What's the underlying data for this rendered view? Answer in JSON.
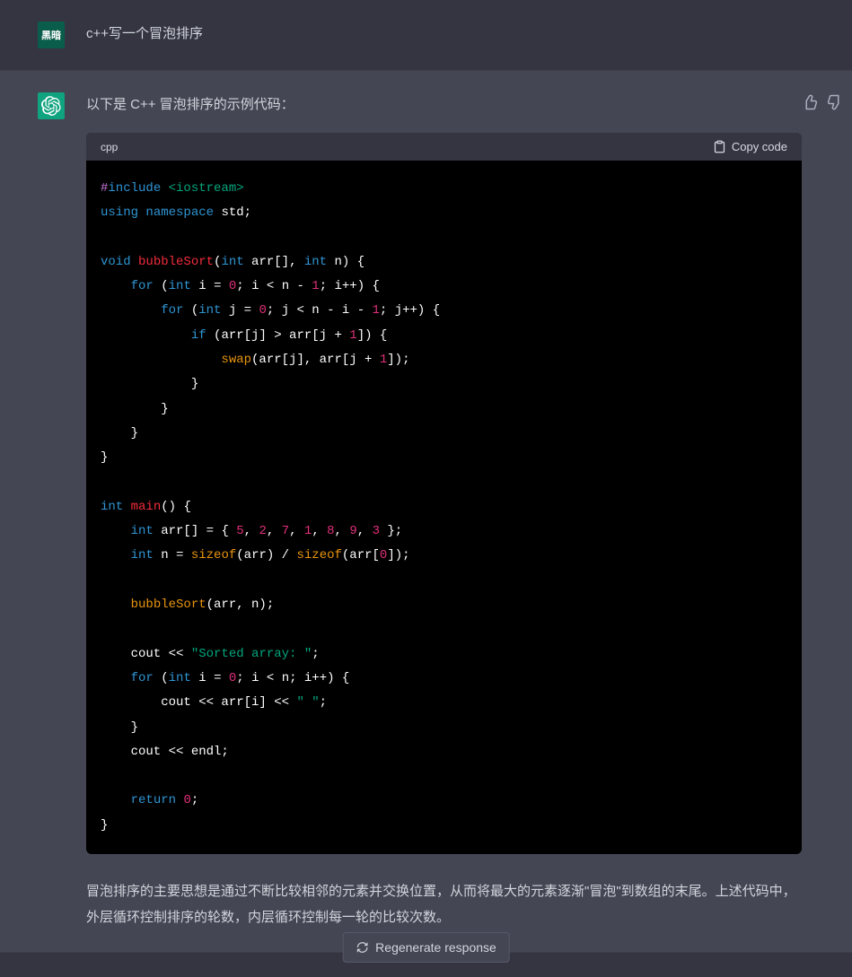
{
  "user": {
    "avatar_text": "黑暗",
    "message": "c++写一个冒泡排序"
  },
  "assistant": {
    "intro": "以下是 C++ 冒泡排序的示例代码：",
    "code_lang": "cpp",
    "copy_label": "Copy code",
    "code": {
      "l1_a": "#",
      "l1_b": "include",
      "l1_c": " <iostream>",
      "l2_a": "using",
      "l2_b": " ",
      "l2_c": "namespace",
      "l2_d": " std;",
      "l3_a": "void",
      "l3_b": " ",
      "l3_c": "bubbleSort",
      "l3_d": "(",
      "l3_e": "int",
      "l3_f": " arr[], ",
      "l3_g": "int",
      "l3_h": " n)",
      "l3_i": " {",
      "l4_a": "    ",
      "l4_b": "for",
      "l4_c": " (",
      "l4_d": "int",
      "l4_e": " i = ",
      "l4_f": "0",
      "l4_g": "; i < n - ",
      "l4_h": "1",
      "l4_i": "; i++) {",
      "l5_a": "        ",
      "l5_b": "for",
      "l5_c": " (",
      "l5_d": "int",
      "l5_e": " j = ",
      "l5_f": "0",
      "l5_g": "; j < n - i - ",
      "l5_h": "1",
      "l5_i": "; j++) {",
      "l6_a": "            ",
      "l6_b": "if",
      "l6_c": " (arr[j] > arr[j + ",
      "l6_d": "1",
      "l6_e": "]) {",
      "l7_a": "                ",
      "l7_b": "swap",
      "l7_c": "(arr[j], arr[j + ",
      "l7_d": "1",
      "l7_e": "]);",
      "l8": "            }",
      "l9": "        }",
      "l10": "    }",
      "l11": "}",
      "l12_a": "int",
      "l12_b": " ",
      "l12_c": "main",
      "l12_d": "()",
      "l12_e": " {",
      "l13_a": "    ",
      "l13_b": "int",
      "l13_c": " arr[] = { ",
      "l13_d": "5",
      "l13_e": ", ",
      "l13_f": "2",
      "l13_g": ", ",
      "l13_h": "7",
      "l13_i": ", ",
      "l13_j": "1",
      "l13_k": ", ",
      "l13_l": "8",
      "l13_m": ", ",
      "l13_n": "9",
      "l13_o": ", ",
      "l13_p": "3",
      "l13_q": " };",
      "l14_a": "    ",
      "l14_b": "int",
      "l14_c": " n = ",
      "l14_d": "sizeof",
      "l14_e": "(arr) / ",
      "l14_f": "sizeof",
      "l14_g": "(arr[",
      "l14_h": "0",
      "l14_i": "]);",
      "l15_a": "    ",
      "l15_b": "bubbleSort",
      "l15_c": "(arr, n);",
      "l16_a": "    cout << ",
      "l16_b": "\"Sorted array: \"",
      "l16_c": ";",
      "l17_a": "    ",
      "l17_b": "for",
      "l17_c": " (",
      "l17_d": "int",
      "l17_e": " i = ",
      "l17_f": "0",
      "l17_g": "; i < n; i++) {",
      "l18_a": "        cout << arr[i] << ",
      "l18_b": "\" \"",
      "l18_c": ";",
      "l19": "    }",
      "l20": "    cout << endl;",
      "l21_a": "    ",
      "l21_b": "return",
      "l21_c": " ",
      "l21_d": "0",
      "l21_e": ";",
      "l22": "}"
    },
    "explanation": "冒泡排序的主要思想是通过不断比较相邻的元素并交换位置，从而将最大的元素逐渐\"冒泡\"到数组的末尾。上述代码中，外层循环控制排序的轮数，内层循环控制每一轮的比较次数。"
  },
  "regenerate_label": "Regenerate response"
}
